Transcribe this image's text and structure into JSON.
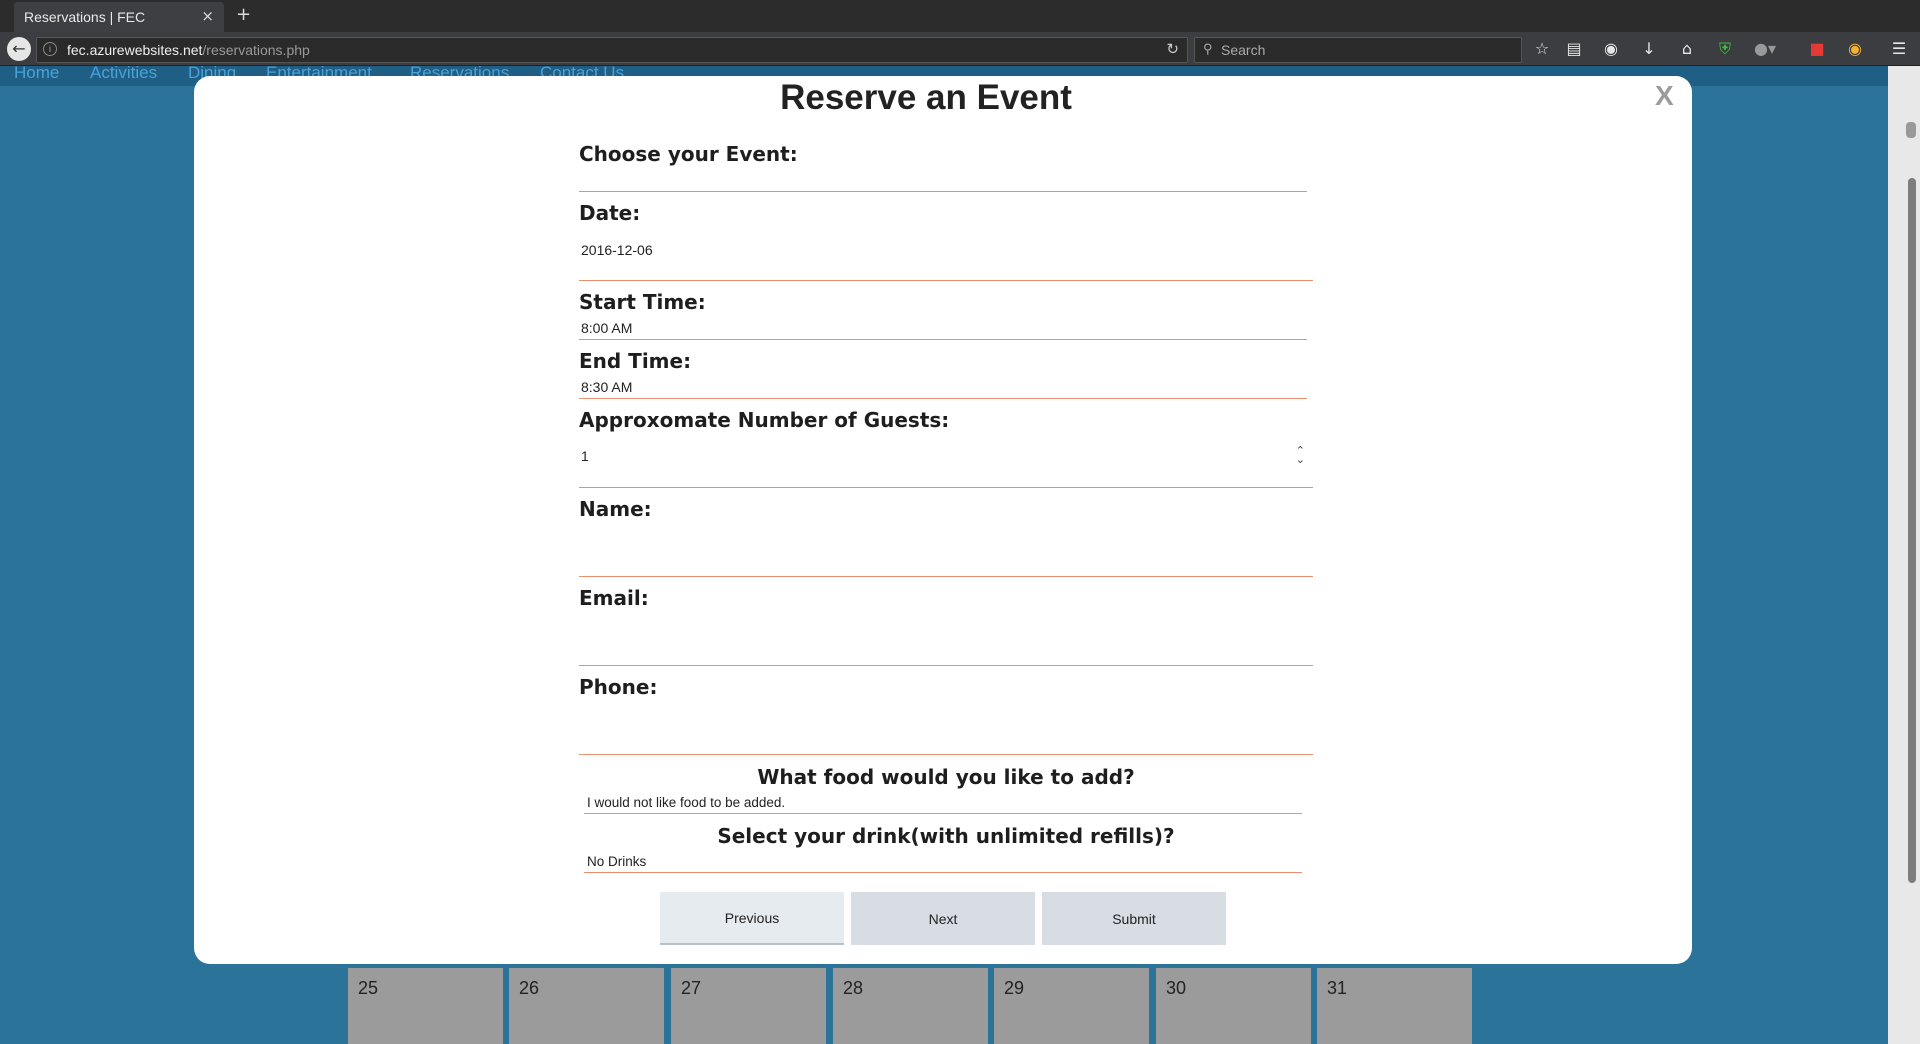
{
  "browser": {
    "tab_title": "Reservations | FEC",
    "tab_close": "×",
    "new_tab": "+",
    "url_host": "fec.azurewebsites.net",
    "url_path": "/reservations.php",
    "search_placeholder": "Search"
  },
  "site_nav": [
    "Home",
    "Activities",
    "Dining",
    "Entertainment",
    "Reservations",
    "Contact Us"
  ],
  "calendar": [
    "25",
    "26",
    "27",
    "28",
    "29",
    "30",
    "31"
  ],
  "modal": {
    "title": "Reserve an Event",
    "close": "X",
    "event_label": "Choose your Event:",
    "event_value": "",
    "date_label": "Date:",
    "date_value": "2016-12-06",
    "start_label": "Start Time:",
    "start_value": "8:00 AM",
    "end_label": "End Time:",
    "end_value": "8:30 AM",
    "guests_label": "Approxomate Number of Guests:",
    "guests_value": "1",
    "name_label": "Name:",
    "name_value": "",
    "email_label": "Email:",
    "email_value": "",
    "phone_label": "Phone:",
    "phone_value": "",
    "food_label": "What food would you like to add?",
    "food_value": "I would not like food to be added.",
    "drink_label": "Select your drink(with unlimited refills)?",
    "drink_value": "No Drinks",
    "buttons": {
      "previous": "Previous",
      "next": "Next",
      "submit": "Submit"
    }
  },
  "colors": {
    "page_bg": "#2b7399",
    "field_underline": "#ea8f72",
    "button_bg": "#d7dde3"
  }
}
